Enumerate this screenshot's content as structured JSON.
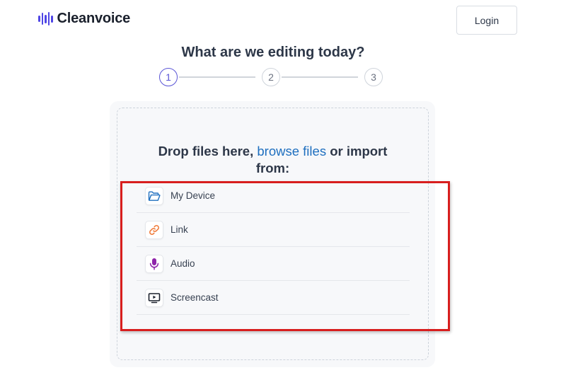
{
  "brand": {
    "name": "Cleanvoice",
    "accent": "#4f46e5"
  },
  "header": {
    "login_label": "Login"
  },
  "page": {
    "title": "What are we editing today?"
  },
  "stepper": {
    "steps": [
      "1",
      "2",
      "3"
    ],
    "active_step": 1
  },
  "drop": {
    "prefix": "Drop files here,",
    "link": "browse files",
    "suffix": "or import from:"
  },
  "sources": [
    {
      "label": "My Device",
      "icon": "folder-icon",
      "color": "#1e6fbf"
    },
    {
      "label": "Link",
      "icon": "link-icon",
      "color": "#f07b3a"
    },
    {
      "label": "Audio",
      "icon": "microphone-icon",
      "color": "#8e24aa"
    },
    {
      "label": "Screencast",
      "icon": "screen-icon",
      "color": "#1a202c"
    }
  ],
  "annotation": {
    "highlight_color": "#d81e1e"
  }
}
